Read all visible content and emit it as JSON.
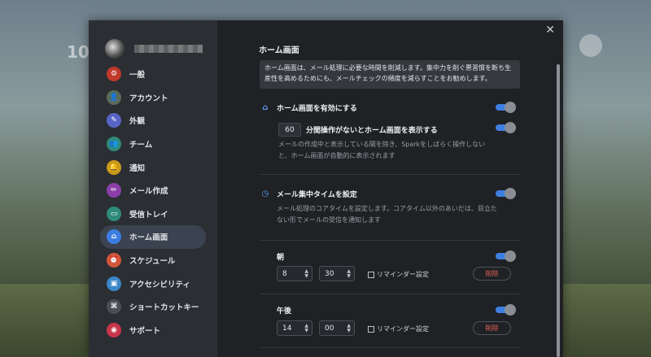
{
  "background": {
    "clock": "10"
  },
  "user": {
    "name": ""
  },
  "sidebar": {
    "items": [
      {
        "label": "一般",
        "icon": "gear-icon",
        "color": "#c0392b",
        "glyph": "⚙"
      },
      {
        "label": "アカウント",
        "icon": "person-icon",
        "color": "#5a6b5a",
        "glyph": "👤"
      },
      {
        "label": "外観",
        "icon": "brush-icon",
        "color": "#5865c8",
        "glyph": "✎"
      },
      {
        "label": "チーム",
        "icon": "team-icon",
        "color": "#2f8a7a",
        "glyph": "👥"
      },
      {
        "label": "通知",
        "icon": "bell-icon",
        "color": "#c99a1a",
        "glyph": "🔔"
      },
      {
        "label": "メール作成",
        "icon": "pen-icon",
        "color": "#8a3fa8",
        "glyph": "✏"
      },
      {
        "label": "受信トレイ",
        "icon": "inbox-icon",
        "color": "#2f8a7a",
        "glyph": "▭"
      },
      {
        "label": "ホーム画面",
        "icon": "home-icon",
        "color": "#3c7de0",
        "glyph": "⌂"
      },
      {
        "label": "スケジュール",
        "icon": "alarm-icon",
        "color": "#d2553a",
        "glyph": "⏰"
      },
      {
        "label": "アクセシビリティ",
        "icon": "monitor-icon",
        "color": "#3a87c8",
        "glyph": "▣"
      },
      {
        "label": "ショートカットキー",
        "icon": "command-icon",
        "color": "#4a4f57",
        "glyph": "⌘"
      },
      {
        "label": "サポート",
        "icon": "lifebuoy-icon",
        "color": "#c8354a",
        "glyph": "◉"
      }
    ],
    "active_index": 7
  },
  "content": {
    "title": "ホーム画面",
    "info": "ホーム画面は、メール処理に必要な時間を削減します。集中力を削ぐ悪習慣を断ち生産性を高めるためにも、メールチェックの頻度を減らすことをお勧めします。",
    "home_enable": {
      "label": "ホーム画面を有効にする",
      "enabled": true
    },
    "idle": {
      "minutes": "60",
      "label": "分間操作がないとホーム画面を表示する",
      "enabled": true,
      "desc": "メールの作成中と表示している間を除き、Sparkをしばらく操作しないと、ホーム画面が自動的に表示されます"
    },
    "focus": {
      "label": "メール集中タイムを設定",
      "enabled": true,
      "desc": "メール処理のコアタイムを設定します。コアタイム以外のあいだは、目立たない形でメールの受信を通知します"
    },
    "slots": [
      {
        "label": "朝",
        "hour": "8",
        "minute": "30",
        "reminder": "リマインダー設定",
        "delete": "削除",
        "enabled": true
      },
      {
        "label": "午後",
        "hour": "14",
        "minute": "00",
        "reminder": "リマインダー設定",
        "delete": "削除",
        "enabled": true
      }
    ]
  },
  "colors": {
    "accent": "#3d7fe0",
    "danger": "#e8615a"
  }
}
